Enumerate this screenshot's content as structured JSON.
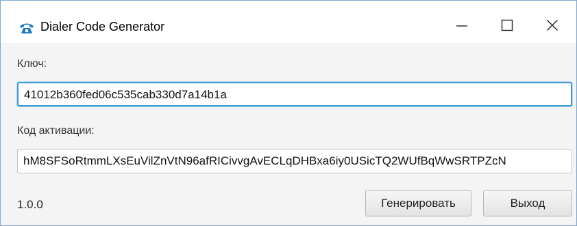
{
  "window": {
    "title": "Dialer Code Generator",
    "app_icon": "telephone-icon",
    "controls": {
      "minimize_icon": "minimize-icon",
      "maximize_icon": "maximize-icon",
      "close_icon": "close-icon"
    }
  },
  "form": {
    "key_label": "Ключ:",
    "key_value": "41012b360fed06c535cab330d7a14b1a",
    "activation_label": "Код активации:",
    "activation_value": "hM8SFSoRtmmLXsEuVilZnVtN96afRICivvgAvECLqDHBxa6iy0USicTQ2WUfBqWwSRTPZcN"
  },
  "footer": {
    "version": "1.0.0",
    "generate_label": "Генерировать",
    "exit_label": "Выход"
  },
  "colors": {
    "accent": "#3c9ad6",
    "icon": "#1e7bbf",
    "window_border": "#7fa8cf"
  }
}
